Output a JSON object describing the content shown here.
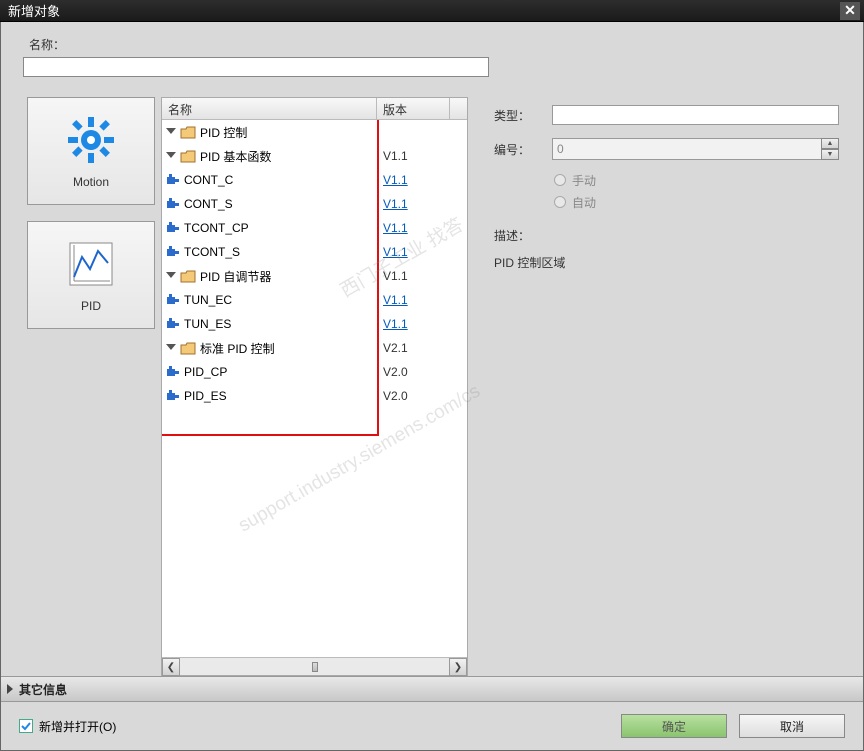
{
  "title": "新增对象",
  "nameLabel": "名称：",
  "nameValue": "",
  "categories": [
    {
      "label": "Motion",
      "kind": "gear"
    },
    {
      "label": "PID",
      "kind": "chart"
    }
  ],
  "treeHeader": {
    "name": "名称",
    "version": "版本"
  },
  "tree": [
    {
      "indent": 1,
      "type": "folder",
      "label": "PID 控制",
      "version": ""
    },
    {
      "indent": 2,
      "type": "folder",
      "label": "PID 基本函数",
      "version": "V1.1"
    },
    {
      "indent": 3,
      "type": "block",
      "label": "CONT_C",
      "version": "V1.1",
      "link": true
    },
    {
      "indent": 3,
      "type": "block",
      "label": "CONT_S",
      "version": "V1.1",
      "link": true
    },
    {
      "indent": 3,
      "type": "block",
      "label": "TCONT_CP",
      "version": "V1.1",
      "link": true
    },
    {
      "indent": 3,
      "type": "block",
      "label": "TCONT_S",
      "version": "V1.1",
      "link": true
    },
    {
      "indent": 2,
      "type": "folder",
      "label": "PID 自调节器",
      "version": "V1.1"
    },
    {
      "indent": 3,
      "type": "block",
      "label": "TUN_EC",
      "version": "V1.1",
      "link": true
    },
    {
      "indent": 3,
      "type": "block",
      "label": "TUN_ES",
      "version": "V1.1",
      "link": true
    },
    {
      "indent": 2,
      "type": "folder",
      "label": "标准 PID 控制",
      "version": "V2.1"
    },
    {
      "indent": 3,
      "type": "block",
      "label": "PID_CP",
      "version": "V2.0"
    },
    {
      "indent": 3,
      "type": "block",
      "label": "PID_ES",
      "version": "V2.0"
    }
  ],
  "props": {
    "typeLabel": "类型：",
    "typeValue": "",
    "numberLabel": "编号：",
    "numberValue": "0",
    "manual": "手动",
    "auto": "自动",
    "descLabel": "描述：",
    "descText": "PID 控制区域"
  },
  "otherInfo": "其它信息",
  "addAndOpen": "新增并打开(O)",
  "ok": "确定",
  "cancel": "取消",
  "watermarks": [
    "西门子工业 找答",
    "support.industry.siemens.com/cs"
  ]
}
